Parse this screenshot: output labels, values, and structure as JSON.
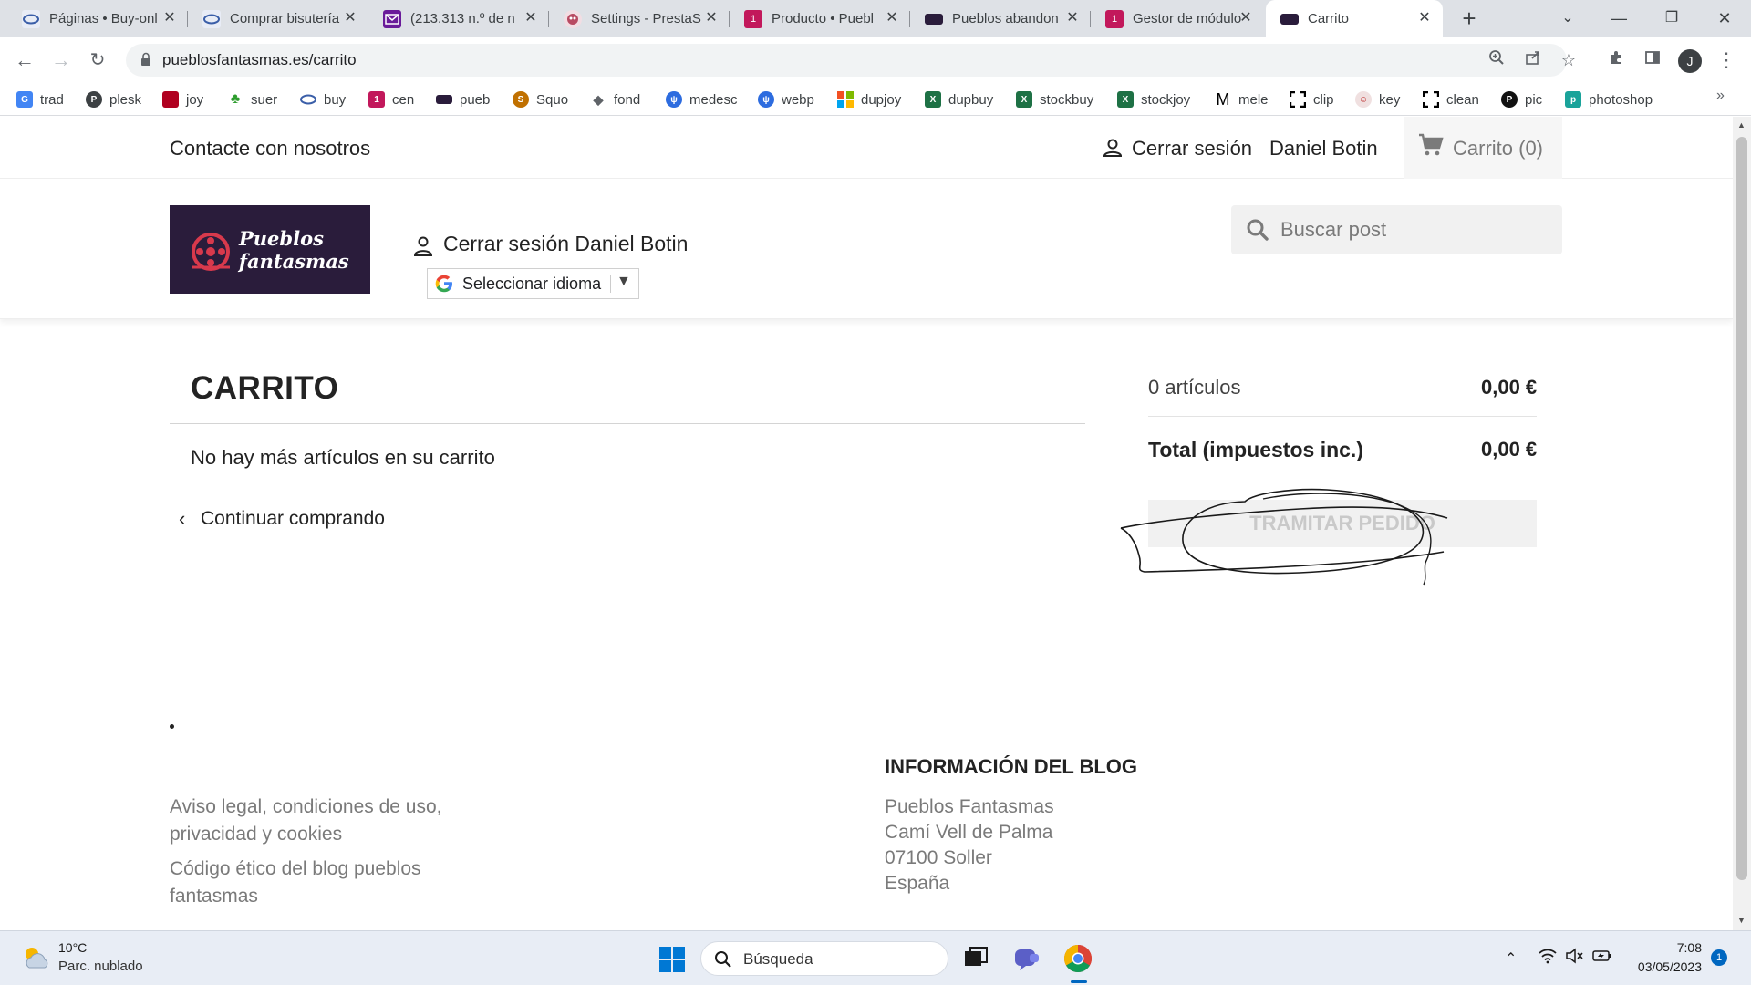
{
  "browser": {
    "tabs": [
      {
        "title": "Páginas • Buy-onl",
        "icon": "ring-icon",
        "color": "#3a5ea8"
      },
      {
        "title": "Comprar bisutería",
        "icon": "ring-icon",
        "color": "#3a5ea8"
      },
      {
        "title": "(213.313 n.º de n",
        "icon": "mail-icon",
        "color": "#6a1b9a"
      },
      {
        "title": "Settings - PrestaS",
        "icon": "prestashop-icon",
        "color": "#b84a62"
      },
      {
        "title": "Producto • Puebl",
        "icon": "store-icon",
        "color": "#c2185b"
      },
      {
        "title": "Pueblos abandon",
        "icon": "site-icon",
        "color": "#2a1c3b"
      },
      {
        "title": "Gestor de módulo",
        "icon": "store-icon",
        "color": "#c2185b"
      },
      {
        "title": "Carrito",
        "icon": "site-icon",
        "color": "#2a1c3b"
      }
    ],
    "url": "pueblosfantasmas.es/carrito",
    "profile_initial": "J",
    "bookmarks": [
      {
        "label": "trad",
        "icon": "translate-icon",
        "color": "#4285f4"
      },
      {
        "label": "plesk",
        "icon": "plesk-icon",
        "color": "#3c4043"
      },
      {
        "label": "joy",
        "icon": "joy-icon",
        "color": "#b00020"
      },
      {
        "label": "suer",
        "icon": "clover-icon",
        "color": "#2e9d2e"
      },
      {
        "label": "buy",
        "icon": "ring-icon",
        "color": "#3a5ea8"
      },
      {
        "label": "cen",
        "icon": "store-icon",
        "color": "#c2185b"
      },
      {
        "label": "pueb",
        "icon": "site-icon",
        "color": "#2a1c3b"
      },
      {
        "label": "Squo",
        "icon": "squo-icon",
        "color": "#c07000"
      },
      {
        "label": "fond",
        "icon": "stack-icon",
        "color": "#5f6368"
      },
      {
        "label": "medesc",
        "icon": "pin-icon",
        "color": "#2d6cdf"
      },
      {
        "label": "webp",
        "icon": "pin-icon",
        "color": "#2d6cdf"
      },
      {
        "label": "dupjoy",
        "icon": "microsoft-icon",
        "color": "#f25022"
      },
      {
        "label": "dupbuy",
        "icon": "excel-icon",
        "color": "#1e7145"
      },
      {
        "label": "stockbuy",
        "icon": "excel-icon",
        "color": "#1e7145"
      },
      {
        "label": "stockjoy",
        "icon": "excel-icon",
        "color": "#1e7145"
      },
      {
        "label": "mele",
        "icon": "m-icon",
        "color": "#000000"
      },
      {
        "label": "clip",
        "icon": "clip-icon",
        "color": "#000000"
      },
      {
        "label": "key",
        "icon": "key-icon",
        "color": "#b71c1c"
      },
      {
        "label": "clean",
        "icon": "clip-icon",
        "color": "#000000"
      },
      {
        "label": "pic",
        "icon": "pic-icon",
        "color": "#111111"
      },
      {
        "label": "photoshop",
        "icon": "photoshop-icon",
        "color": "#1aa39a"
      }
    ]
  },
  "site": {
    "contact": "Contacte con nosotros",
    "logout": "Cerrar sesión",
    "username": "Daniel Botin",
    "cart_label": "Carrito (0)",
    "user_line": "Cerrar sesión Daniel Botin",
    "logo_line1": "Pueblos",
    "logo_line2": "fantasmas",
    "language_select": "Seleccionar idioma",
    "search_placeholder": "Buscar post",
    "accent": "#2a1c3b"
  },
  "cart": {
    "title": "CARRITO",
    "empty_message": "No hay más artículos en su carrito",
    "continue": "Continuar comprando",
    "summary": {
      "items_label": "0 artículos",
      "items_value": "0,00 €",
      "total_label": "Total (impuestos inc.)",
      "total_value": "0,00 €",
      "checkout": "Tramitar pedido"
    }
  },
  "footer": {
    "links": [
      "Aviso legal, condiciones de uso, privacidad y cookies",
      "Código ético del blog pueblos fantasmas"
    ],
    "blog_info_title": "Información del blog",
    "address": [
      "Pueblos Fantasmas",
      "Camí Vell de Palma",
      "07100 Soller",
      "España"
    ]
  },
  "taskbar": {
    "temperature": "10°C",
    "condition": "Parc. nublado",
    "search": "Búsqueda",
    "time": "7:08",
    "date": "03/05/2023",
    "notifications": "1"
  }
}
